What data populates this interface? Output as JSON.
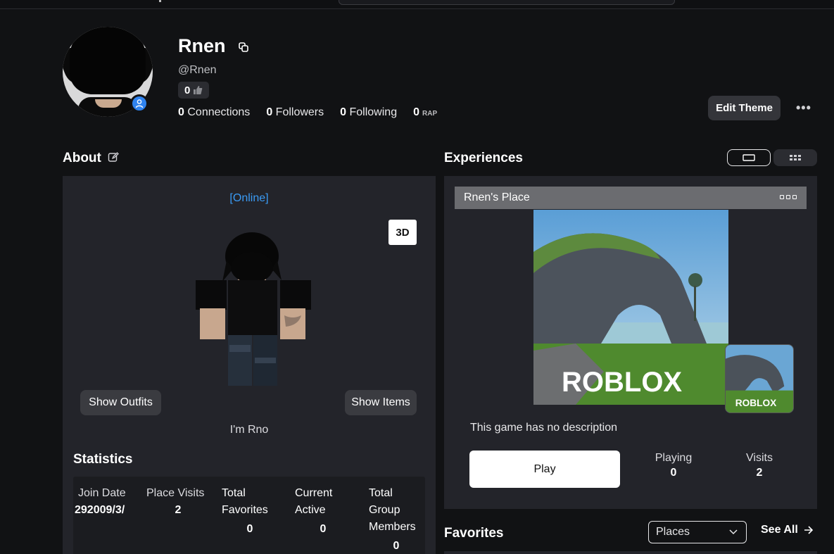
{
  "profile": {
    "display_name": "Rnen",
    "handle": "@Rnen",
    "likes": "0",
    "connections_count": "0",
    "connections_label": "Connections",
    "followers_count": "0",
    "followers_label": "Followers",
    "following_count": "0",
    "following_label": "Following",
    "rap_count": "0",
    "rap_label": "RAP",
    "edit_theme_label": "Edit Theme",
    "more_label": "•••"
  },
  "about": {
    "title": "About",
    "status": "[Online]",
    "view_3d_label": "3D",
    "show_outfits_label": "Show Outfits",
    "show_items_label": "Show Items",
    "blurb": "I'm Rno"
  },
  "statistics": {
    "title": "Statistics",
    "columns": [
      {
        "label": "Join Date",
        "value": "292009/3/"
      },
      {
        "label": "Place Visits",
        "value": "2"
      },
      {
        "label": "Total Favorites",
        "value": "0"
      },
      {
        "label": "Current Active",
        "value": "0"
      },
      {
        "label": "Total Group Members",
        "value": "0"
      }
    ]
  },
  "experiences": {
    "title": "Experiences",
    "game_name": "Rnen's Place",
    "thumbnail_brand": "ROBLOX",
    "description": "This game has no description",
    "play_label": "Play",
    "playing_label": "Playing",
    "playing_value": "0",
    "visits_label": "Visits",
    "visits_value": "2"
  },
  "favorites": {
    "title": "Favorites",
    "selected_filter": "Places",
    "see_all_label": "See All"
  },
  "colors": {
    "background": "#111214",
    "panel": "#23242a",
    "online_blue": "#3a9bf5",
    "presence_blue": "#2f83f0"
  },
  "icons": {
    "copy": "copy-icon",
    "edit": "edit-icon",
    "thumbs_up": "thumbs-up-icon",
    "presence": "person-icon",
    "list_view": "list-view-icon",
    "grid_view": "grid-view-icon",
    "chevron": "chevron-down-icon",
    "arrow": "arrow-right-icon"
  }
}
